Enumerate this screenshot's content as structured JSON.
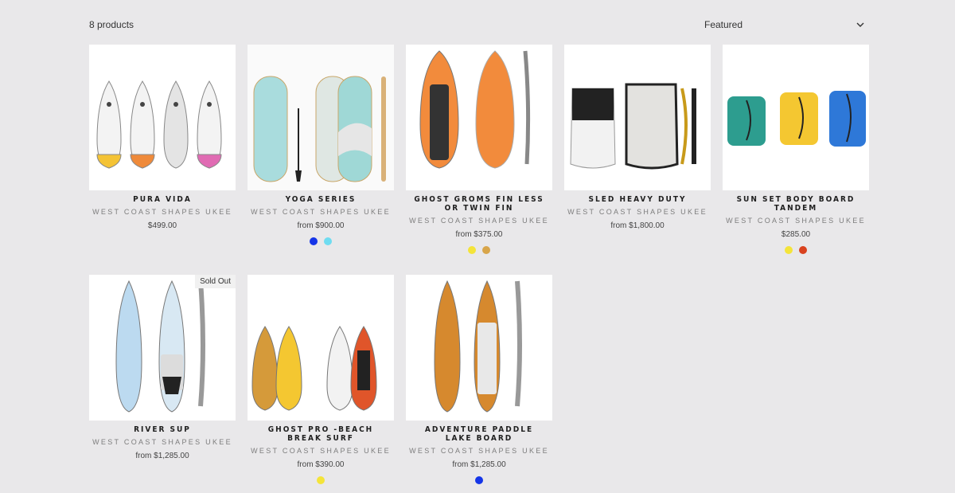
{
  "toolbar": {
    "product_count": "8 products",
    "sort_selected": "Featured",
    "sort_icon": "chevron-down-icon"
  },
  "products": [
    {
      "title": "PURA VIDA",
      "vendor": "WEST COAST SHAPES UKEE",
      "price": "$499.00",
      "swatches": []
    },
    {
      "title": "YOGA SERIES",
      "vendor": "WEST COAST SHAPES UKEE",
      "price": "from $900.00",
      "swatches": [
        "#1535e8",
        "#6fdcf1"
      ]
    },
    {
      "title": "GHOST GROMS FIN LESS OR TWIN FIN",
      "vendor": "WEST COAST SHAPES UKEE",
      "price": "from $375.00",
      "swatches": [
        "#f4e43a",
        "#d8a54a"
      ]
    },
    {
      "title": "SLED HEAVY DUTY",
      "vendor": "WEST COAST SHAPES UKEE",
      "price": "from $1,800.00",
      "swatches": []
    },
    {
      "title": "SUN SET BODY BOARD TANDEM",
      "vendor": "WEST COAST SHAPES UKEE",
      "price": "$285.00",
      "swatches": [
        "#f4e43a",
        "#d9421f"
      ]
    },
    {
      "title": "RIVER SUP",
      "vendor": "WEST COAST SHAPES UKEE",
      "price": "from $1,285.00",
      "swatches": [],
      "badge": "Sold Out"
    },
    {
      "title": "GHOST PRO -BEACH BREAK SURF",
      "vendor": "WEST COAST SHAPES UKEE",
      "price": "from $390.00",
      "swatches": [
        "#f4e43a"
      ]
    },
    {
      "title": "ADVENTURE PADDLE LAKE BOARD",
      "vendor": "WEST COAST SHAPES UKEE",
      "price": "from $1,285.00",
      "swatches": [
        "#1535e8"
      ]
    }
  ]
}
